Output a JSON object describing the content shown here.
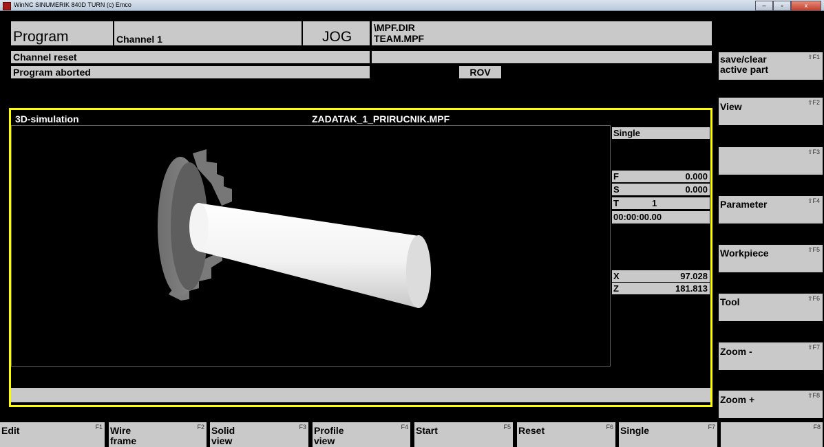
{
  "window": {
    "title": "WinNC SINUMERIK 840D TURN (c) Emco",
    "minimize": "–",
    "maximize": "▫",
    "close": "x"
  },
  "header": {
    "area": "Program",
    "channel": "Channel 1",
    "mode": "JOG",
    "path": "\\MPF.DIR",
    "file": "TEAM.MPF",
    "line1": "Channel reset",
    "line2": "Program aborted",
    "rov": "ROV"
  },
  "sim": {
    "title": "3D-simulation",
    "program": "ZADATAK_1_PRIRUCNIK.MPF",
    "mode": "Single",
    "f_label": "F",
    "f_value": "0.000",
    "s_label": "S",
    "s_value": "0.000",
    "t_label": "T",
    "t_value": "1",
    "time": "00:00:00.00",
    "x_label": "X",
    "x_value": "97.028",
    "z_label": "Z",
    "z_value": "181.813"
  },
  "softkeys_right": [
    {
      "label": "save/clear active part",
      "key": "⇧F1"
    },
    {
      "label": "View",
      "key": "⇧F2"
    },
    {
      "label": "",
      "key": "⇧F3"
    },
    {
      "label": "Parameter",
      "key": "⇧F4"
    },
    {
      "label": "Workpiece",
      "key": "⇧F5"
    },
    {
      "label": "Tool",
      "key": "⇧F6"
    },
    {
      "label": "Zoom -",
      "key": "⇧F7"
    },
    {
      "label": "Zoom +",
      "key": "⇧F8"
    }
  ],
  "softkeys_bottom": [
    {
      "label": "Edit",
      "key": "F1"
    },
    {
      "label": "Wire frame",
      "key": "F2"
    },
    {
      "label": "Solid view",
      "key": "F3"
    },
    {
      "label": "Profile view",
      "key": "F4"
    },
    {
      "label": "Start",
      "key": "F5"
    },
    {
      "label": "Reset",
      "key": "F6"
    },
    {
      "label": "Single",
      "key": "F7"
    },
    {
      "label": "",
      "key": "F8"
    }
  ],
  "colors": {
    "panel": "#c9c9c9",
    "frame_highlight": "#ffff00",
    "background": "#000000"
  }
}
